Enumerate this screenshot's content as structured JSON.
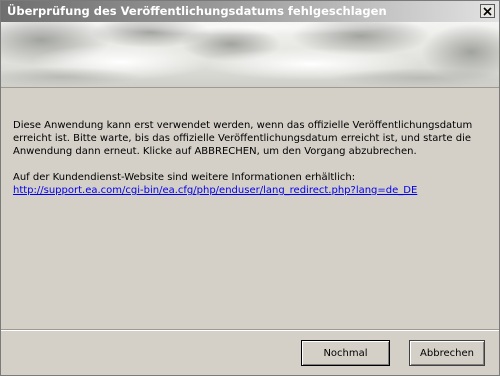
{
  "window": {
    "title": "Überprüfung des Veröffentlichungsdatums fehlgeschlagen",
    "close_icon": "close-icon"
  },
  "message": {
    "paragraph1": "Diese Anwendung kann erst verwendet werden, wenn das offizielle Veröffentlichungsdatum erreicht ist. Bitte warte, bis das offizielle Veröffentlichungsdatum erreicht ist, und starte die Anwendung dann erneut. Klicke auf ABBRECHEN, um den Vorgang abzubrechen.",
    "paragraph2_prefix": "Auf der Kundendienst-Website sind weitere Informationen erhältlich: ",
    "link_text": "http://support.ea.com/cgi-bin/ea.cfg/php/enduser/lang_redirect.php?lang=de_DE"
  },
  "buttons": {
    "retry_label": "Nochmal",
    "cancel_label": "Abbrechen"
  },
  "colors": {
    "dialog_bg": "#d4d0c8",
    "link": "#0000ee",
    "title_text": "#ffffff"
  }
}
